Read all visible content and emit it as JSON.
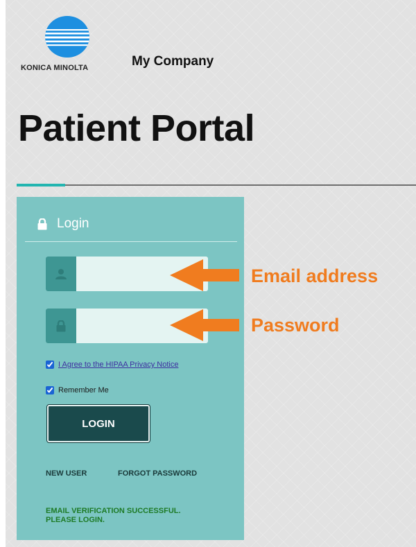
{
  "brand": {
    "logo_text": "KONICA MINOLTA",
    "company": "My Company",
    "accent_color": "#23b5b0"
  },
  "page": {
    "title": "Patient Portal"
  },
  "login": {
    "title": "Login",
    "lock_icon": "lock-icon",
    "email_field": {
      "value": "",
      "placeholder": "",
      "icon": "user-icon"
    },
    "password_field": {
      "value": "",
      "placeholder": "",
      "icon": "lock-icon"
    },
    "hipaa_label": "I Agree to the HIPAA Privacy Notice",
    "hipaa_checked": true,
    "remember_label": "Remember Me",
    "remember_checked": true,
    "button_label": "LOGIN",
    "new_user_label": "NEW USER",
    "forgot_password_label": "FORGOT PASSWORD",
    "status_message_line1": "EMAIL VERIFICATION SUCCESSFUL.",
    "status_message_line2": "PLEASE LOGIN.",
    "panel_color": "#7cc5c3",
    "button_color": "#1a4a4c",
    "status_color": "#1d7a25"
  },
  "annotations": {
    "email_label": "Email address",
    "password_label": "Password",
    "color": "#f07c1f"
  }
}
